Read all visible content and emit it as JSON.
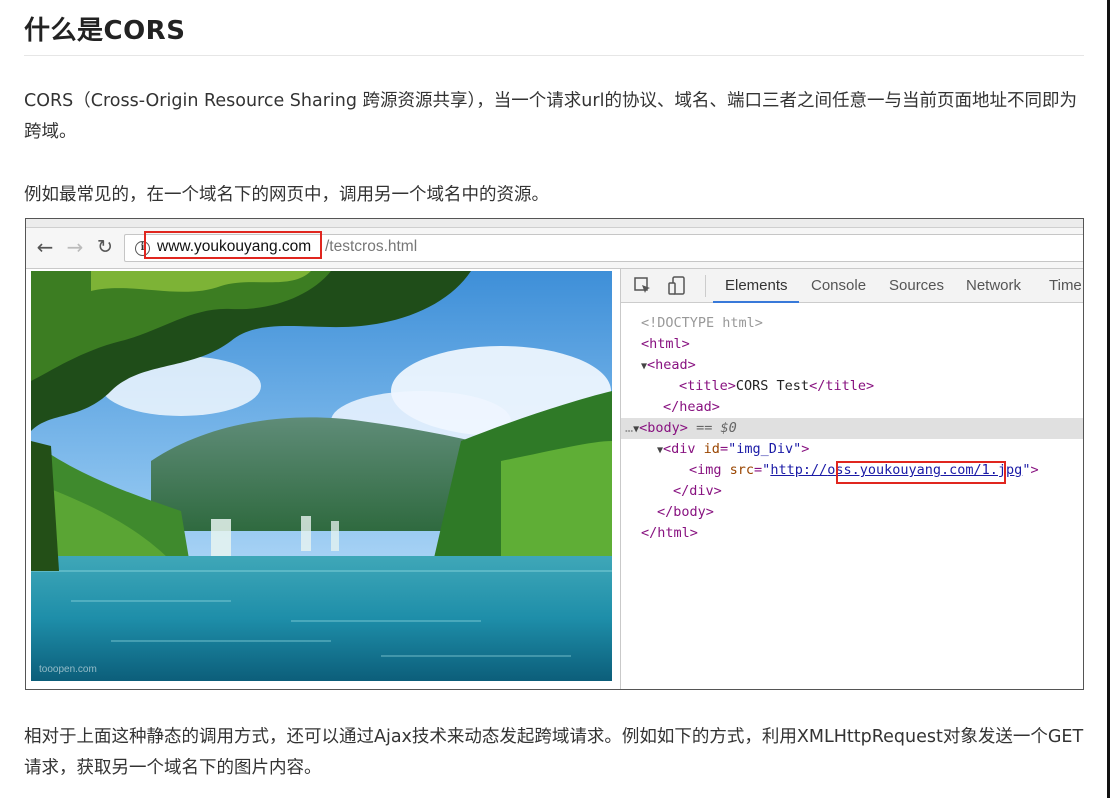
{
  "article": {
    "title": "什么是CORS",
    "paragraph1": "CORS（Cross-Origin Resource Sharing 跨源资源共享），当一个请求url的协议、域名、端口三者之间任意一与当前页面地址不同即为跨域。",
    "paragraph2": "例如最常见的，在一个域名下的网页中，调用另一个域名中的资源。",
    "paragraph3": "相对于上面这种静态的调用方式，还可以通过Ajax技术来动态发起跨域请求。例如如下的方式，利用XMLHttpRequest对象发送一个GET请求，获取另一个域名下的图片内容。"
  },
  "browser": {
    "url_host": "www.youkouyang.com",
    "url_path": "/testcros.html",
    "image_watermark": "tooopen.com"
  },
  "devtools": {
    "tabs": [
      "Elements",
      "Console",
      "Sources",
      "Network",
      "Time"
    ],
    "dom": {
      "doctype": "<!DOCTYPE html>",
      "html_open": "<html>",
      "head_open": "<head>",
      "title_open": "<title>",
      "title_text": "CORS Test",
      "title_close": "</title>",
      "head_close": "</head>",
      "body_open": "<body>",
      "body_marker": "== $0",
      "div_open_tag": "<div ",
      "div_attr": "id",
      "div_val": "\"img_Div\"",
      "img_open_tag": "<img ",
      "img_attr": "src",
      "img_src_prefix": "http://",
      "img_src_host": "oss.youkouyang.com",
      "img_src_path": "/1.jpg",
      "div_close": "</div>",
      "body_close": "</body>",
      "html_close": "</html>"
    }
  },
  "colors": {
    "highlight_box": "#e0261f",
    "tag": "#881280",
    "attr": "#994500",
    "value": "#1a1aa6"
  }
}
